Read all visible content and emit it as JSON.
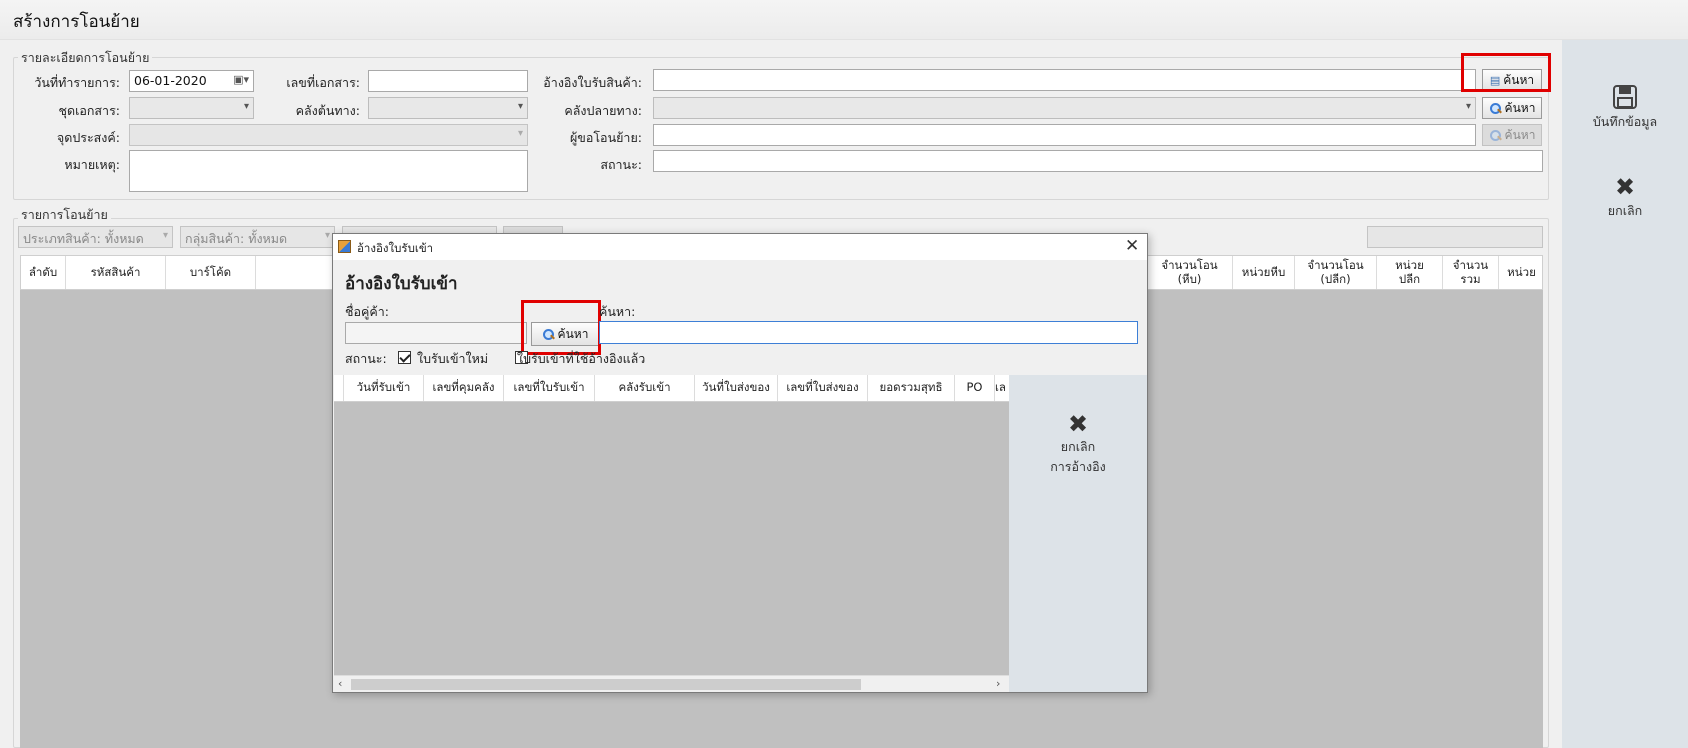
{
  "page_title": "สร้างการโอนย้าย",
  "details": {
    "legend": "รายละเอียดการโอนย้าย",
    "date_label": "วันที่ทำรายการ:",
    "date_value": "06-01-2020",
    "doc_no_label": "เลขที่เอกสาร:",
    "doc_no_value": "",
    "ref_label": "อ้างอิงใบรับสินค้า:",
    "ref_value": "",
    "search_btn": "ค้นหา",
    "doc_set_label": "ชุดเอกสาร:",
    "src_wh_label": "คลังต้นทาง:",
    "dst_wh_label": "คลังปลายทาง:",
    "purpose_label": "จุดประสงค์:",
    "requester_label": "ผู้ขอโอนย้าย:",
    "note_label": "หมายเหตุ:",
    "status_label": "สถานะ:"
  },
  "items": {
    "legend": "รายการโอนย้าย",
    "filter_type": "ประเภทสินค้า: ทั้งหมด",
    "filter_group": "กลุ่มสินค้า: ทั้งหมด",
    "columns_left": [
      "ลำดับ",
      "รหัสสินค้า",
      "บาร์โค้ด"
    ],
    "columns_right": [
      "จำนวนโอน\n(หีบ)",
      "หน่วยหีบ",
      "จำนวนโอน\n(ปลีก)",
      "หน่วย\nปลีก",
      "จำนวนรวม",
      "หน่วย"
    ]
  },
  "sidebar": {
    "save_label": "บันทึกข้อมูล",
    "cancel_label": "ยกเลิก"
  },
  "dialog": {
    "window_title": "อ้างอิงใบรับเข้า",
    "heading": "อ้างอิงใบรับเข้า",
    "vendor_label": "ชื่อคู่ค้า:",
    "vendor_value": "",
    "search_btn": "ค้นหา",
    "search_label": "ค้นหา:",
    "search_value": "",
    "status_label": "สถานะ:",
    "status_new_label": "ใบรับเข้าใหม่",
    "status_new_checked": true,
    "status_used_label": "ใบรับเข้าที่ใช้อ้างอิงแล้ว",
    "status_used_checked": false,
    "columns": [
      "วันที่รับเข้า",
      "เลขที่คุมคลัง",
      "เลขที่ใบรับเข้า",
      "คลังรับเข้า",
      "วันที่ใบส่งของ",
      "เลขที่ใบส่งของ",
      "ยอดรวมสุทธิ",
      "PO",
      "เล"
    ],
    "cancel_ref_label_1": "ยกเลิก",
    "cancel_ref_label_2": "การอ้างอิง"
  }
}
